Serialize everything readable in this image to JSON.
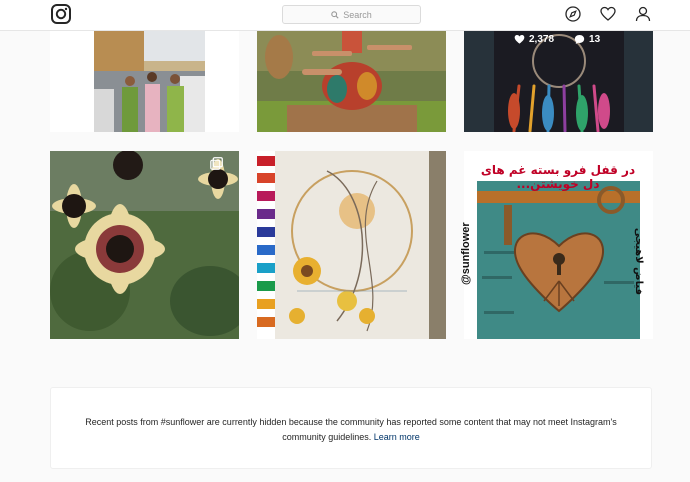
{
  "header": {
    "logo_name": "instagram-logo",
    "search_placeholder": "Search",
    "icons": [
      "compass-icon",
      "heart-icon",
      "user-icon"
    ]
  },
  "grid": {
    "posts": [
      {
        "id": "post-1"
      },
      {
        "id": "post-2"
      },
      {
        "id": "post-3",
        "likes": "2,378",
        "comments": "13"
      },
      {
        "id": "post-4",
        "multi": true
      },
      {
        "id": "post-5"
      },
      {
        "id": "post-6",
        "hashtag": "@sunflower",
        "persian_top": "در قفل فرو بسته غم های دل خویشتن...",
        "persian_side": "فیاض لاهیجی"
      }
    ]
  },
  "notice": {
    "text_line1": "Recent posts from #sunflower are currently hidden because the community has reported some content that may not meet Instagram's",
    "text_line2": "community guidelines.",
    "learn_more": "Learn more"
  },
  "colors": {
    "link": "#003569",
    "border": "#dbdbdb",
    "background": "#fafafa",
    "persian_text": "#c00026"
  }
}
